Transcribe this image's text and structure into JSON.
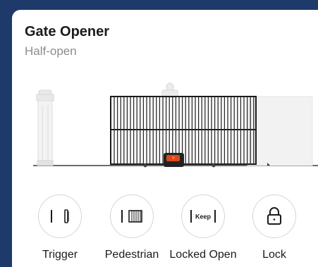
{
  "card": {
    "title": "Gate Opener",
    "status": "Half-open"
  },
  "gate": {
    "open_fraction": 0.5,
    "motor_color": "#d84a1b"
  },
  "actions": [
    {
      "label": "Trigger",
      "icon": "trigger-icon"
    },
    {
      "label": "Pedestrian",
      "icon": "pedestrian-icon"
    },
    {
      "label": "Locked Open",
      "icon": "keep-open-icon",
      "icon_text": "Keep"
    },
    {
      "label": "Lock",
      "icon": "lock-icon"
    }
  ]
}
